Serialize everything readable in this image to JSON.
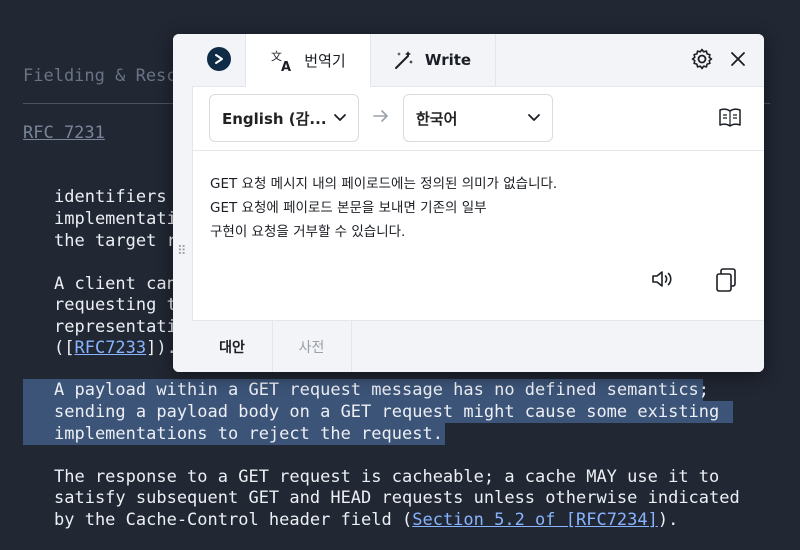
{
  "document": {
    "header": "Fielding & Reschke",
    "rfc_link": "RFC 7231",
    "lines": [
      "identifiers (",
      "implementatio",
      "the target re",
      "",
      "A client can",
      "requesting t",
      "representati",
      "([",
      "",
      "A payload within a GET request message has no defined semantics;",
      "sending a payload body on a GET request might cause some existing",
      "implementations to reject the request.",
      "",
      "The response to a GET request is cacheable; a cache MAY use it to",
      "satisfy subsequent GET and HEAD requests unless otherwise indicated",
      "by the Cache-Control header field ("
    ],
    "line7_link": "RFC7233",
    "line7_suffix": "]).",
    "line15_link": "Section 5.2 of [RFC7234]",
    "line15_suffix": ")."
  },
  "popup": {
    "tabs": {
      "translate": "번역기",
      "write": "Write"
    },
    "source_language": "English (감...",
    "target_language": "한국어",
    "result_lines": [
      "GET 요청 메시지 내의 페이로드에는 정의된 의미가 없습니다.",
      "GET 요청에 페이로드 본문을 보내면 기존의 일부",
      "구현이 요청을 거부할 수 있습니다."
    ],
    "bottom_tabs": {
      "alternatives": "대안",
      "dictionary": "사전"
    },
    "colors": {
      "logo_bg": "#0f2b46",
      "highlight": "#3c5478",
      "link": "#88b4ff"
    }
  }
}
